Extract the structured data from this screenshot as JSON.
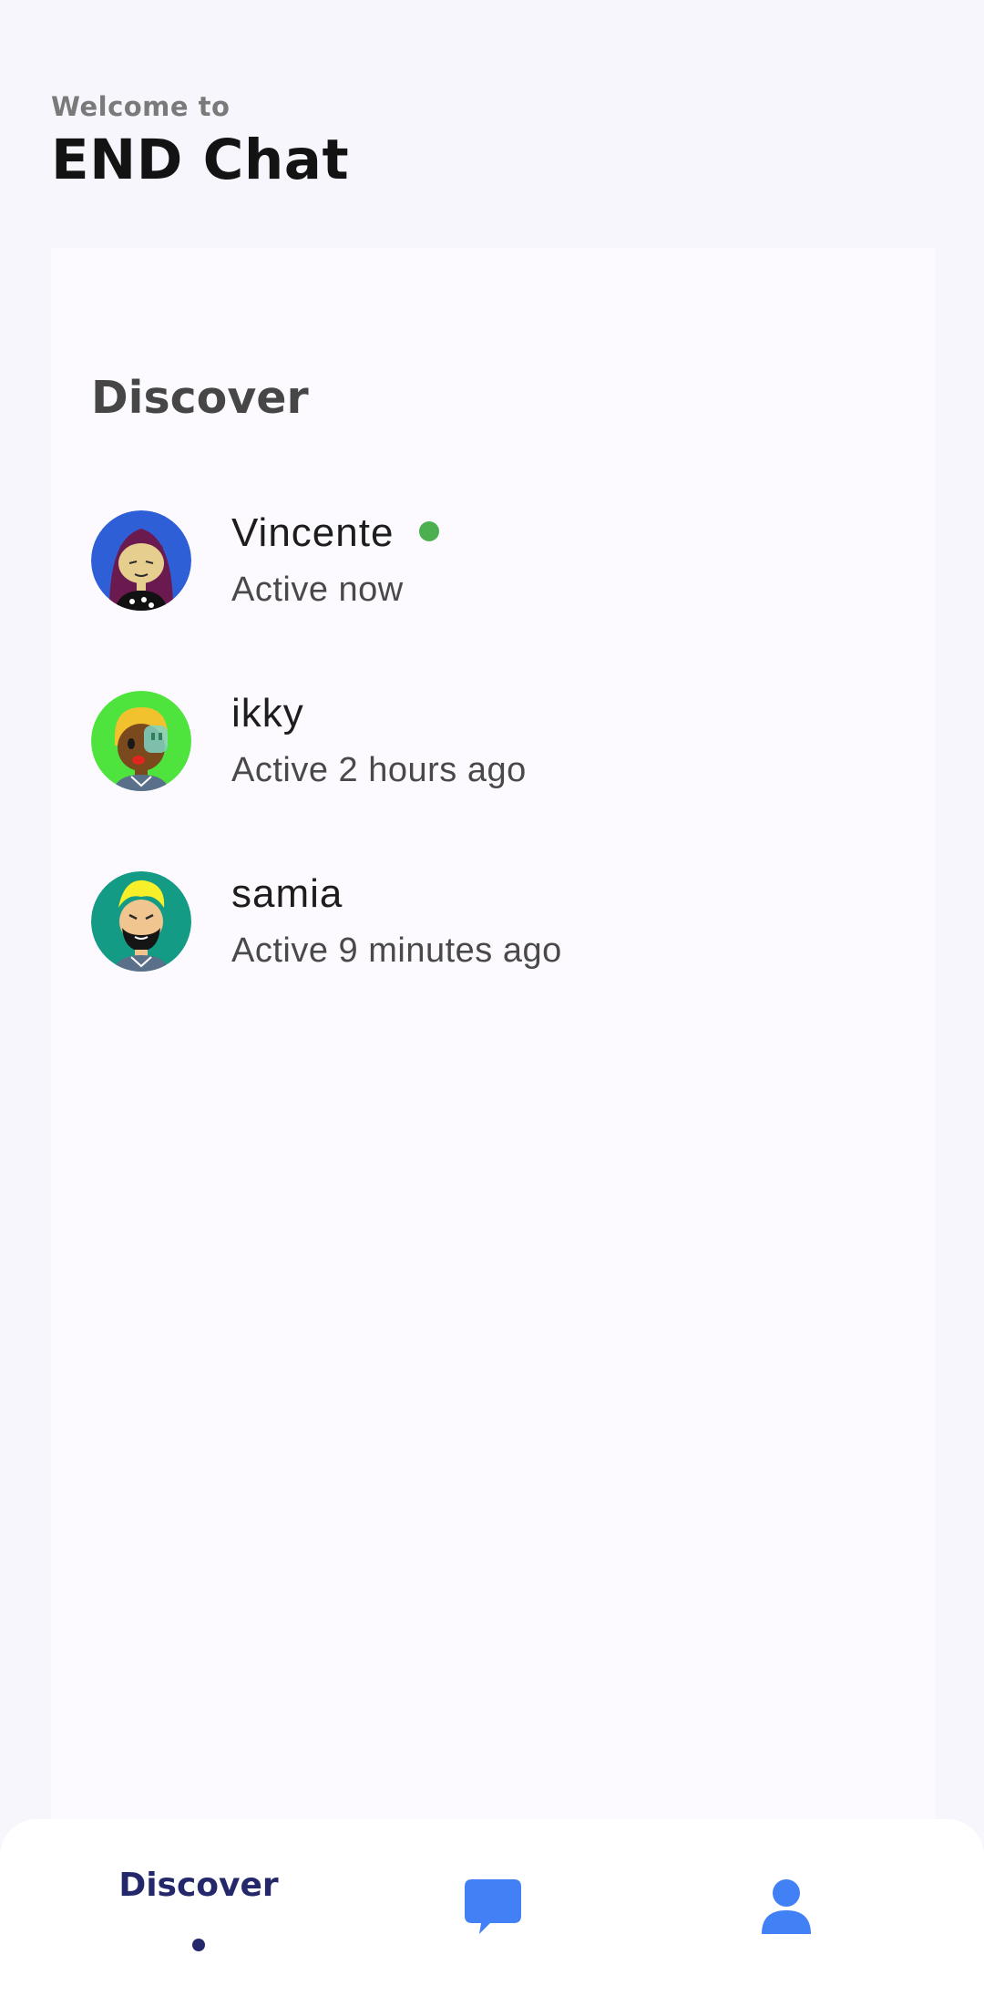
{
  "header": {
    "welcome": "Welcome to",
    "app_title": "END Chat"
  },
  "discover": {
    "title": "Discover",
    "users": [
      {
        "name": "Vincente",
        "status": "Active now",
        "online": true,
        "avatar_bg": "#2f5fd6"
      },
      {
        "name": "ikky",
        "status": "Active 2 hours ago",
        "online": false,
        "avatar_bg": "#4fe33e"
      },
      {
        "name": "samia",
        "status": "Active 9 minutes ago",
        "online": false,
        "avatar_bg": "#149b86"
      }
    ]
  },
  "bottom_nav": {
    "discover_label": "Discover",
    "active_tab": "discover",
    "icons": [
      "chat-bubble-icon",
      "person-icon"
    ]
  },
  "colors": {
    "online": "#4caf50",
    "nav_active": "#24286b",
    "nav_icon": "#4180f5"
  }
}
